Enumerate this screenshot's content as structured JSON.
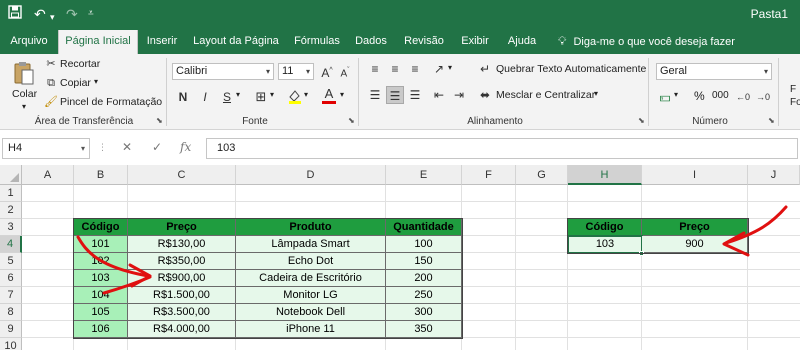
{
  "app": {
    "window_title": "Pasta1"
  },
  "quick_access": {
    "save_icon": "save-icon",
    "undo_icon": "undo-icon",
    "redo_icon": "redo-icon",
    "customize_icon": "customize-qat-icon"
  },
  "tabs": [
    {
      "label": "Arquivo"
    },
    {
      "label": "Página Inicial"
    },
    {
      "label": "Inserir"
    },
    {
      "label": "Layout da Página"
    },
    {
      "label": "Fórmulas"
    },
    {
      "label": "Dados"
    },
    {
      "label": "Revisão"
    },
    {
      "label": "Exibir"
    },
    {
      "label": "Ajuda"
    }
  ],
  "tell_me": "Diga-me o que você deseja fazer",
  "ribbon": {
    "clipboard": {
      "paste": "Colar",
      "cut": "Recortar",
      "copy": "Copiar",
      "format_painter": "Pincel de Formatação",
      "group_label": "Área de Transferência"
    },
    "font": {
      "family": "Calibri",
      "size": "11",
      "group_label": "Fonte",
      "bold": "N",
      "italic": "I",
      "underline": "S",
      "font_color": "A",
      "accent_red": "#e00000"
    },
    "alignment": {
      "wrap_text": "Quebrar Texto Automaticamente",
      "merge_center": "Mesclar e Centralizar",
      "group_label": "Alinhamento"
    },
    "number": {
      "format": "Geral",
      "percent": "%",
      "thousands": "000",
      "group_label": "Número",
      "cut_off": "F",
      "cut_off2": "Fo"
    }
  },
  "formula_bar": {
    "name_box": "H4",
    "cancel": "✕",
    "enter": "✓",
    "fx": "fx",
    "value": "103"
  },
  "grid": {
    "columns": [
      "A",
      "B",
      "C",
      "D",
      "E",
      "F",
      "G",
      "H",
      "I",
      "J"
    ],
    "rows": [
      "1",
      "2",
      "3",
      "4",
      "5",
      "6",
      "7",
      "8",
      "9",
      "10"
    ],
    "selected_cell": "H4",
    "accent": "#217346"
  },
  "table": {
    "headers": [
      "Código",
      "Preço",
      "Produto",
      "Quantidade"
    ],
    "rows": [
      [
        "101",
        "R$130,00",
        "Lâmpada Smart",
        "100"
      ],
      [
        "102",
        "R$350,00",
        "Echo Dot",
        "150"
      ],
      [
        "103",
        "R$900,00",
        "Cadeira de Escritório",
        "200"
      ],
      [
        "104",
        "R$1.500,00",
        "Monitor LG",
        "250"
      ],
      [
        "105",
        "R$3.500,00",
        "Notebook Dell",
        "300"
      ],
      [
        "106",
        "R$4.000,00",
        "iPhone 11",
        "350"
      ]
    ],
    "header_color": "#1f9d3f",
    "code_color": "#a8f0b8",
    "row_color": "#e6f8ea"
  },
  "lookup": {
    "headers": [
      "Código",
      "Preço"
    ],
    "values": [
      "103",
      "900"
    ]
  },
  "annotations": {
    "arrow_color": "#e01010"
  }
}
